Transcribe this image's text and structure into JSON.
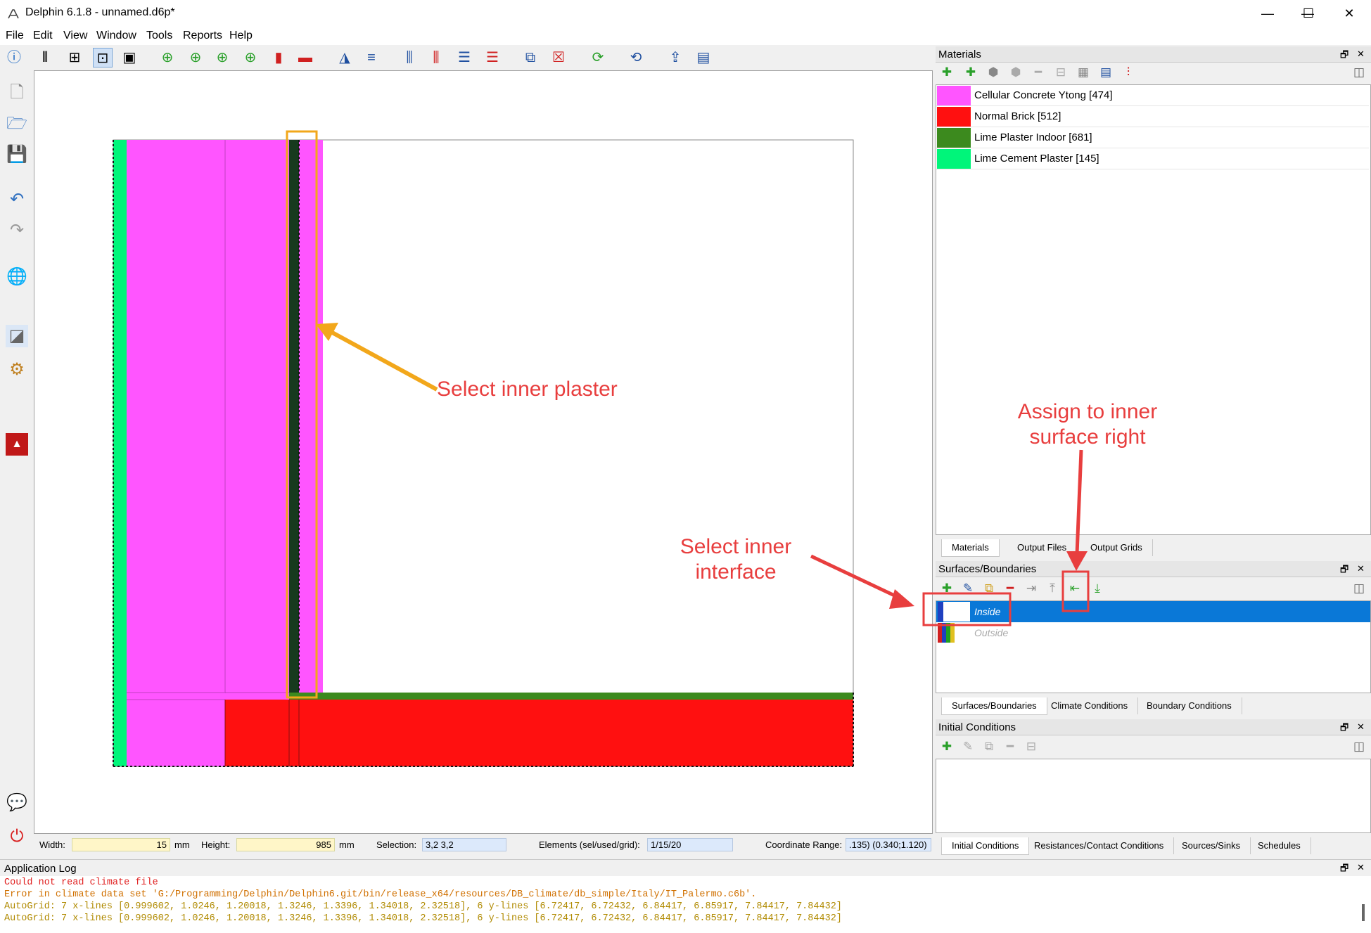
{
  "window": {
    "title": "Delphin 6.1.8 - unnamed.d6p*",
    "minimize": "—",
    "maximize": "☐",
    "close": "✕"
  },
  "menu": [
    "File",
    "Edit",
    "View",
    "Window",
    "Tools",
    "Reports",
    "Help"
  ],
  "materials_panel": {
    "title": "Materials",
    "items": [
      {
        "label": "Cellular Concrete Ytong [474]",
        "color": "#ff55ff"
      },
      {
        "label": "Normal Brick [512]",
        "color": "#ff1010"
      },
      {
        "label": "Lime Plaster Indoor [681]",
        "color": "#3c8a1e"
      },
      {
        "label": "Lime Cement Plaster [145]",
        "color": "#00f57a"
      }
    ],
    "tabs": [
      "Materials",
      "Output Files",
      "Output Grids"
    ]
  },
  "surfaces_panel": {
    "title": "Surfaces/Boundaries",
    "items": [
      {
        "label": "Inside",
        "selected": true
      },
      {
        "label": "Outside",
        "selected": false
      }
    ],
    "tabs": [
      "Surfaces/Boundaries",
      "Climate Conditions",
      "Boundary Conditions"
    ]
  },
  "initial_panel": {
    "title": "Initial Conditions",
    "tabs": [
      "Initial Conditions",
      "Resistances/Contact Conditions",
      "Sources/Sinks",
      "Schedules"
    ]
  },
  "status": {
    "width_label": "Width:",
    "width_value": "15",
    "width_unit": "mm",
    "height_label": "Height:",
    "height_value": "985",
    "height_unit": "mm",
    "selection_label": "Selection:",
    "selection_value": "3,2  3,2",
    "elements_label": "Elements (sel/used/grid):",
    "elements_value": "1/15/20",
    "coord_label": "Coordinate Range:",
    "coord_value": ".135)  (0.340;1.120)"
  },
  "app_log": {
    "title": "Application Log",
    "lines": [
      "Could not read climate file",
      "Error in climate data set 'G:/Programming/Delphin/Delphin6.git/bin/release_x64/resources/DB_climate/db_simple/Italy/IT_Palermo.c6b'.",
      "AutoGrid: 7 x-lines [0.999602, 1.0246, 1.20018, 1.3246, 1.3396, 1.34018, 2.32518], 6 y-lines [6.72417, 6.72432, 6.84417, 6.85917, 7.84417, 7.84432]",
      "AutoGrid: 7 x-lines [0.999602, 1.0246, 1.20018, 1.3246, 1.3396, 1.34018, 2.32518], 6 y-lines [6.72417, 6.72432, 6.84417, 6.85917, 7.84417, 7.84432]"
    ]
  },
  "annotations": {
    "select_plaster": "Select inner plaster",
    "select_interface_1": "Select inner",
    "select_interface_2": "interface",
    "assign_1": "Assign to inner",
    "assign_2": "surface right"
  },
  "colors": {
    "accent_orange": "#f2a71b",
    "annotation_red": "#e83e3e",
    "selection_blue": "#0a78d7"
  }
}
